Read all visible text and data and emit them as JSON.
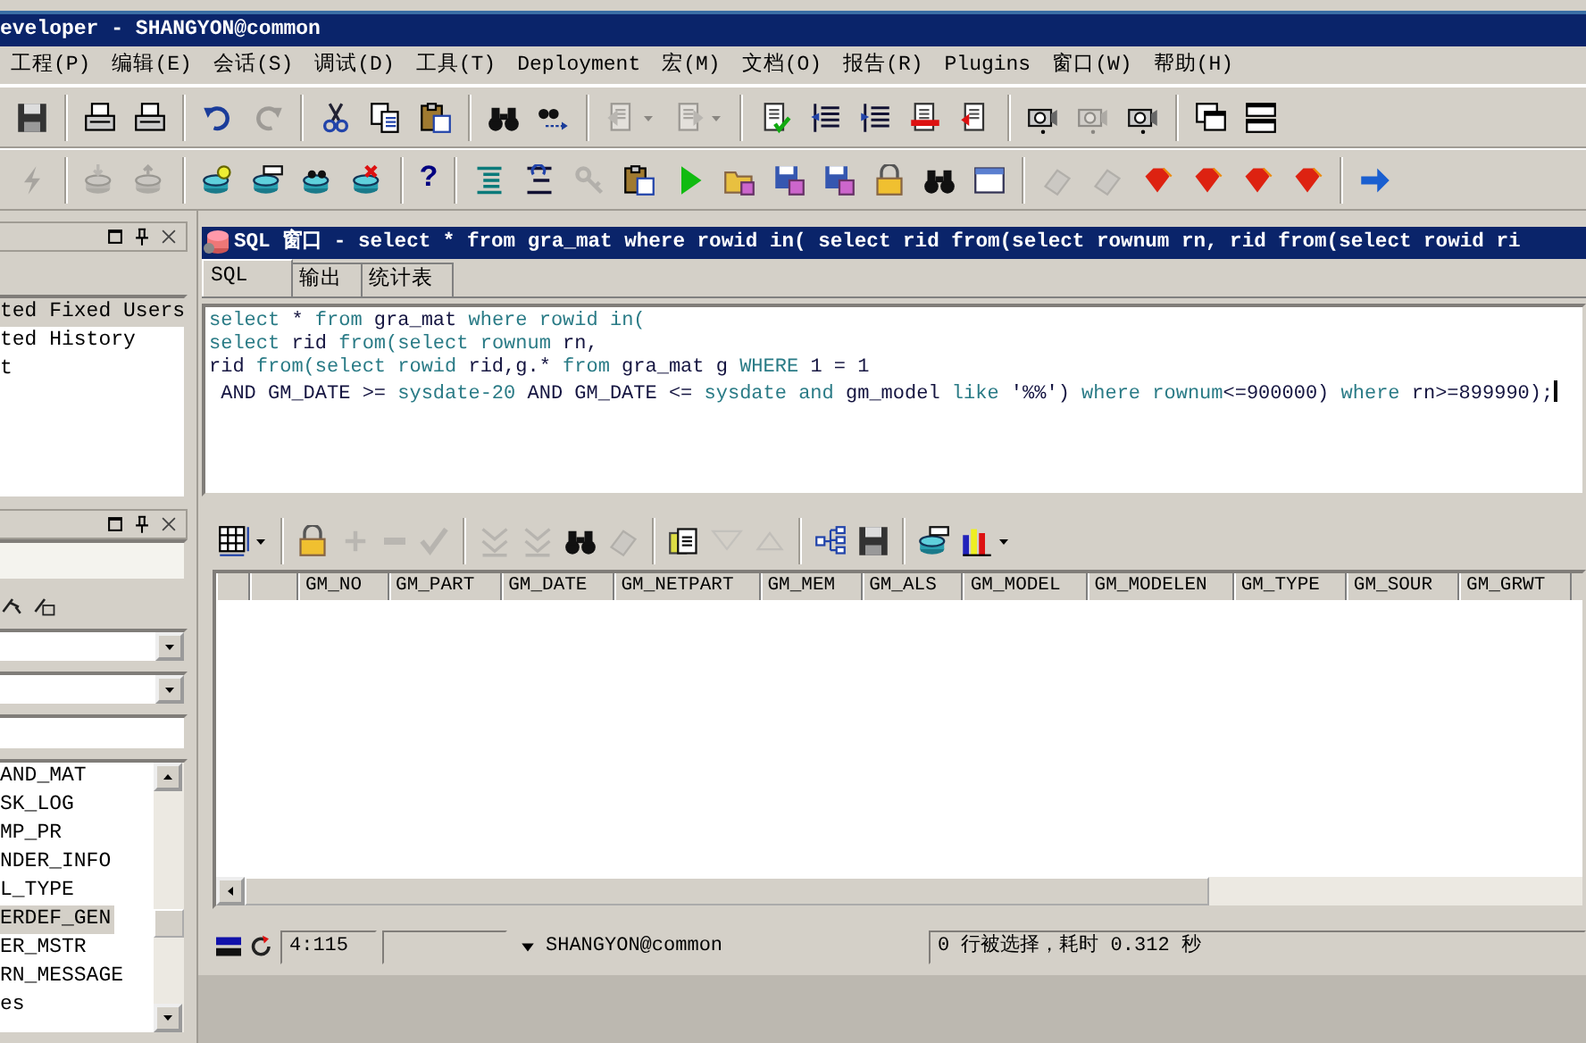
{
  "window": {
    "title": "eveloper - SHANGYON@common"
  },
  "menu": [
    "工程(P)",
    "编辑(E)",
    "会话(S)",
    "调试(D)",
    "工具(T)",
    "Deployment",
    "宏(M)",
    "文档(O)",
    "报告(R)",
    "Plugins",
    "窗口(W)",
    "帮助(H)"
  ],
  "toolbars": [
    [
      {
        "kind": "save",
        "disabled": false
      },
      {
        "kind": "sep"
      },
      {
        "kind": "print",
        "disabled": false
      },
      {
        "kind": "print",
        "disabled": false
      },
      {
        "kind": "sep"
      },
      {
        "kind": "undo",
        "disabled": false
      },
      {
        "kind": "redo",
        "disabled": true
      },
      {
        "kind": "sep"
      },
      {
        "kind": "cut",
        "disabled": false
      },
      {
        "kind": "copy",
        "disabled": false
      },
      {
        "kind": "paste",
        "disabled": false
      },
      {
        "kind": "sep"
      },
      {
        "kind": "find",
        "disabled": false
      },
      {
        "kind": "find-next",
        "disabled": false
      },
      {
        "kind": "sep"
      },
      {
        "kind": "back",
        "disabled": true,
        "dropdown": true
      },
      {
        "kind": "forward",
        "disabled": true,
        "dropdown": true
      },
      {
        "kind": "sep"
      },
      {
        "kind": "doc-check",
        "disabled": false
      },
      {
        "kind": "indent",
        "disabled": false
      },
      {
        "kind": "outdent",
        "disabled": false
      },
      {
        "kind": "doc-red",
        "disabled": false
      },
      {
        "kind": "doc-arrow",
        "disabled": false
      },
      {
        "kind": "sep"
      },
      {
        "kind": "camera",
        "disabled": false
      },
      {
        "kind": "camera",
        "disabled": true
      },
      {
        "kind": "camera",
        "disabled": false
      },
      {
        "kind": "sep"
      },
      {
        "kind": "windows",
        "disabled": false
      },
      {
        "kind": "tile",
        "disabled": false
      }
    ],
    [
      {
        "kind": "lightning",
        "disabled": true
      },
      {
        "kind": "sep"
      },
      {
        "kind": "db-down",
        "disabled": true
      },
      {
        "kind": "db-up",
        "disabled": true
      },
      {
        "kind": "sep"
      },
      {
        "kind": "db-bulb",
        "disabled": false
      },
      {
        "kind": "db-sql",
        "disabled": false
      },
      {
        "kind": "db-find",
        "disabled": false
      },
      {
        "kind": "db-x",
        "disabled": false
      },
      {
        "kind": "sep"
      },
      {
        "kind": "help",
        "disabled": false,
        "glyph": "?"
      },
      {
        "kind": "sep"
      },
      {
        "kind": "align",
        "disabled": false
      },
      {
        "kind": "align2",
        "disabled": false
      },
      {
        "kind": "keys",
        "disabled": true
      },
      {
        "kind": "paste",
        "disabled": false
      },
      {
        "kind": "run",
        "disabled": false
      },
      {
        "kind": "open-folder",
        "disabled": false
      },
      {
        "kind": "save-doc",
        "disabled": false
      },
      {
        "kind": "save-doc",
        "disabled": false
      },
      {
        "kind": "lock",
        "disabled": false
      },
      {
        "kind": "find",
        "disabled": false
      },
      {
        "kind": "window",
        "disabled": false
      },
      {
        "kind": "sep"
      },
      {
        "kind": "eraser",
        "disabled": true
      },
      {
        "kind": "eraser",
        "disabled": true
      },
      {
        "kind": "gem",
        "disabled": false
      },
      {
        "kind": "gem",
        "disabled": false
      },
      {
        "kind": "gem",
        "disabled": false
      },
      {
        "kind": "gem",
        "disabled": false
      },
      {
        "kind": "sep"
      },
      {
        "kind": "arrow-right",
        "disabled": false
      }
    ]
  ],
  "left_panels": [
    {
      "items": [
        {
          "label": "ted Fixed Users",
          "selected": true
        },
        {
          "label": "ted History",
          "selected": false
        },
        {
          "label": "t",
          "selected": false
        }
      ]
    },
    {
      "items": [
        {
          "label": "AND_MAT",
          "selected": false
        },
        {
          "label": "SK_LOG",
          "selected": false
        },
        {
          "label": "MP_PR",
          "selected": false
        },
        {
          "label": "NDER_INFO",
          "selected": false
        },
        {
          "label": "L_TYPE",
          "selected": false
        },
        {
          "label": "ERDEF_GEN",
          "selected": true
        },
        {
          "label": "ER_MSTR",
          "selected": false
        },
        {
          "label": "RN_MESSAGE",
          "selected": false
        },
        {
          "label": "es",
          "selected": false
        }
      ]
    }
  ],
  "sql_window": {
    "title": "SQL 窗口 - select * from gra_mat where rowid in( select rid from(select rownum rn, rid from(select rowid ri",
    "tabs": [
      {
        "label": "SQL",
        "selected": true
      },
      {
        "label": "输出",
        "selected": false
      },
      {
        "label": "统计表",
        "selected": false
      }
    ],
    "code": [
      [
        {
          "text": "select",
          "kind": "keyword"
        },
        {
          "text": " * ",
          "kind": "plain"
        },
        {
          "text": "from",
          "kind": "keyword"
        },
        {
          "text": " gra_mat ",
          "kind": "plain"
        },
        {
          "text": "where rowid in(",
          "kind": "keyword"
        }
      ],
      [
        {
          "text": "select",
          "kind": "keyword"
        },
        {
          "text": " rid ",
          "kind": "plain"
        },
        {
          "text": "from(select rownum",
          "kind": "keyword"
        },
        {
          "text": " rn,",
          "kind": "plain"
        }
      ],
      [
        {
          "text": "rid ",
          "kind": "plain"
        },
        {
          "text": "from(select rowid",
          "kind": "keyword"
        },
        {
          "text": " rid,g.* ",
          "kind": "plain"
        },
        {
          "text": "from",
          "kind": "keyword"
        },
        {
          "text": " gra_mat g ",
          "kind": "plain"
        },
        {
          "text": "WHERE",
          "kind": "keyword"
        },
        {
          "text": " 1 = 1",
          "kind": "plain"
        }
      ],
      [
        {
          "text": " AND GM_DATE >= ",
          "kind": "plain"
        },
        {
          "text": "sysdate-20",
          "kind": "keyword"
        },
        {
          "text": " AND GM_DATE <= ",
          "kind": "plain"
        },
        {
          "text": "sysdate and",
          "kind": "keyword"
        },
        {
          "text": " gm_model ",
          "kind": "plain"
        },
        {
          "text": "like",
          "kind": "keyword"
        },
        {
          "text": " '%%') ",
          "kind": "plain"
        },
        {
          "text": "where rownum",
          "kind": "keyword"
        },
        {
          "text": "<=900000) ",
          "kind": "plain"
        },
        {
          "text": "where",
          "kind": "keyword"
        },
        {
          "text": " rn>=899990);",
          "kind": "plain"
        }
      ]
    ]
  },
  "result_grid": {
    "toolbar": [
      {
        "kind": "grid",
        "disabled": false,
        "dropdown": true
      },
      {
        "kind": "sep"
      },
      {
        "kind": "lock",
        "disabled": false
      },
      {
        "kind": "plus",
        "disabled": true
      },
      {
        "kind": "minus",
        "disabled": true
      },
      {
        "kind": "check",
        "disabled": true
      },
      {
        "kind": "sep"
      },
      {
        "kind": "double-down",
        "disabled": true
      },
      {
        "kind": "double-down",
        "disabled": true
      },
      {
        "kind": "find",
        "disabled": false
      },
      {
        "kind": "eraser",
        "disabled": true
      },
      {
        "kind": "sep"
      },
      {
        "kind": "doc-stack",
        "disabled": false
      },
      {
        "kind": "filter",
        "disabled": true
      },
      {
        "kind": "up-triangle",
        "disabled": true
      },
      {
        "kind": "sep"
      },
      {
        "kind": "tree",
        "disabled": false
      },
      {
        "kind": "save",
        "disabled": false
      },
      {
        "kind": "sep"
      },
      {
        "kind": "db-sql",
        "disabled": false
      },
      {
        "kind": "chart",
        "disabled": false,
        "dropdown": true
      }
    ],
    "columns": [
      "GM_NO",
      "GM_PART",
      "GM_DATE",
      "GM_NETPART",
      "GM_MEM",
      "GM_ALS",
      "GM_MODEL",
      "GM_MODELEN",
      "GM_TYPE",
      "GM_SOUR",
      "GM_GRWT"
    ]
  },
  "status_bar": {
    "position": "4:115",
    "connection": "SHANGYON@common",
    "message": "0 行被选择，耗时 0.312 秒"
  }
}
